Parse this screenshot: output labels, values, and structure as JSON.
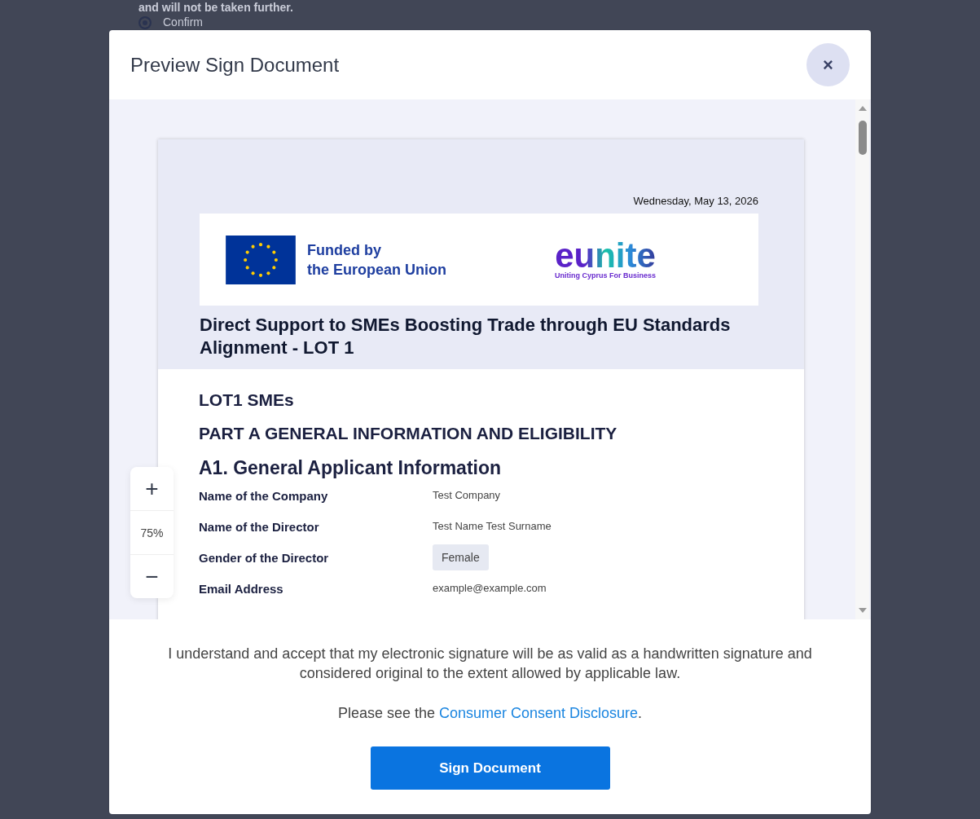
{
  "background": {
    "text": "and will not be taken further.",
    "radio": {
      "label": "Confirm",
      "selected": true
    }
  },
  "dialog": {
    "title": "Preview Sign Document",
    "close": "×"
  },
  "document": {
    "date": "Wednesday, May 13, 2026",
    "banner": {
      "funded": "Funded by",
      "union": "the European Union",
      "brand": "eunite",
      "tagline": "Uniting Cyprus For Business"
    },
    "title": "Direct Support to SMEs Boosting Trade through EU Standards Alignment - LOT 1",
    "headings": [
      "LOT1 SMEs",
      "PART A GENERAL INFORMATION AND ELIGIBILITY",
      "A1.  General Applicant Information"
    ],
    "fields": [
      {
        "label": "Name of the Company",
        "value": "Test Company",
        "kind": "text"
      },
      {
        "label": "Name of the Director",
        "value": "Test Name Test Surname",
        "kind": "text"
      },
      {
        "label": "Gender of the Director",
        "value": "Female",
        "kind": "chip"
      },
      {
        "label": "Email Address",
        "value": "example@example.com",
        "kind": "text"
      }
    ]
  },
  "zoom": {
    "plus": "+",
    "level": "75%",
    "minus": "−"
  },
  "footer": {
    "consent": "I understand and accept that my electronic signature will be as valid as a handwritten signature and considered original to the extent allowed by applicable law.",
    "see": "Please see the",
    "link": "Consumer Consent Disclosure",
    "end": ".",
    "button": "Sign Document"
  }
}
